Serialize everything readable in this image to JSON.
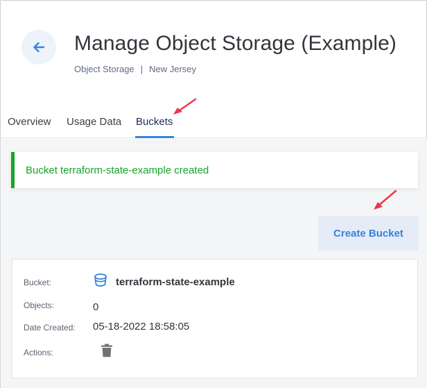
{
  "header": {
    "title": "Manage Object Storage (Example)",
    "breadcrumb": {
      "service": "Object Storage",
      "separator": "|",
      "region": "New Jersey"
    },
    "back_icon": "arrow-left-icon"
  },
  "tabs": [
    {
      "label": "Overview",
      "active": false
    },
    {
      "label": "Usage Data",
      "active": false
    },
    {
      "label": "Buckets",
      "active": true
    }
  ],
  "notice": {
    "text": "Bucket terraform-state-example created",
    "color": "#17a32a"
  },
  "actions": {
    "create_bucket_label": "Create Bucket"
  },
  "bucket": {
    "bucket_label": "Bucket:",
    "name": "terraform-state-example",
    "objects_label": "Objects:",
    "objects": "0",
    "date_label": "Date Created:",
    "date_created": "05-18-2022 18:58:05",
    "actions_label": "Actions:",
    "bucket_icon": "bucket-icon",
    "delete_icon": "trash-icon"
  },
  "colors": {
    "accent": "#3683dc",
    "annotation_arrow": "#e8384f",
    "success": "#17a32a"
  }
}
